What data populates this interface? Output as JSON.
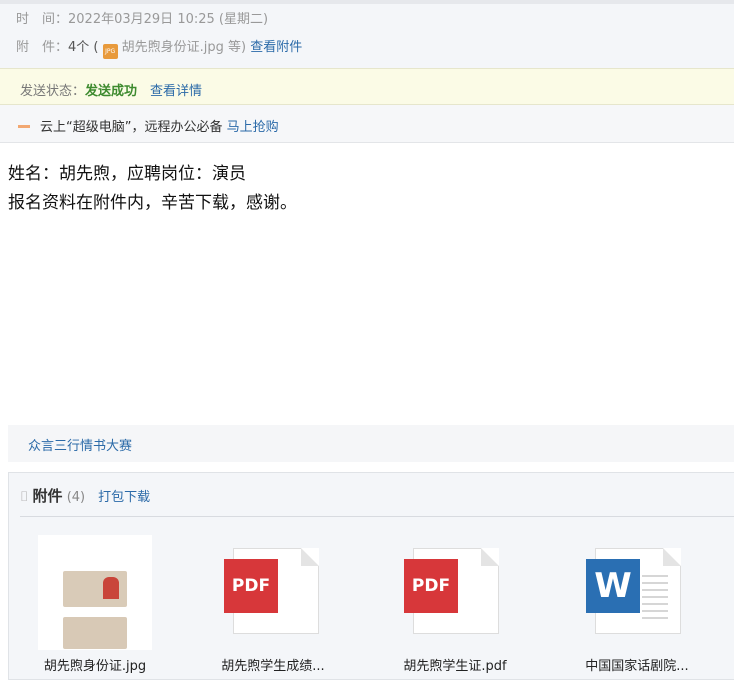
{
  "header": {
    "time_label": "时　间：",
    "time_value": "2022年03月29日 10:25 (星期二)",
    "attach_label": "附　件：",
    "attach_count": "4个 (",
    "attach_icon": "JPG",
    "attach_first": "胡先煦身份证.jpg 等)",
    "view_attachments": "查看附件"
  },
  "status": {
    "label": "发送状态：",
    "value": "发送成功",
    "details": "查看详情",
    "success_color": "#3d8a2e"
  },
  "promo": {
    "text": "云上“超级电脑”，远程办公必备",
    "link": "马上抢购"
  },
  "body": {
    "line1": "姓名：胡先煦，应聘岗位：演员",
    "line2": "报名资料在附件内，辛苦下载，感谢。"
  },
  "promo2": {
    "link": "众言三行情书大赛"
  },
  "attachments": {
    "title": "附件",
    "count": "(4)",
    "download_all": "打包下载",
    "files": [
      {
        "name": "胡先煦身份证.jpg",
        "type": "image"
      },
      {
        "name": "胡先煦学生成绩...",
        "type": "PDF"
      },
      {
        "name": "胡先煦学生证.pdf",
        "type": "PDF"
      },
      {
        "name": "中国国家话剧院...",
        "type": "W"
      }
    ]
  }
}
